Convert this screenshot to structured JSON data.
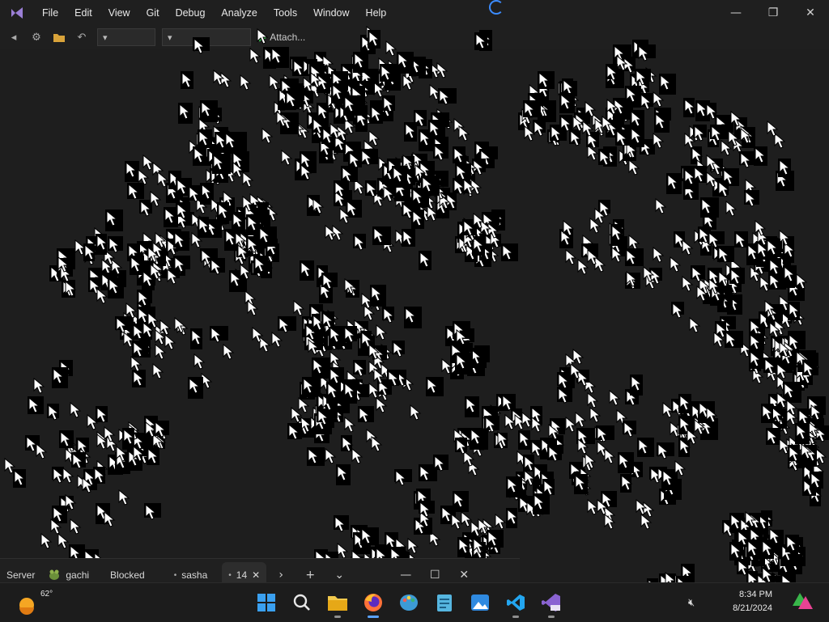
{
  "window": {
    "menu": [
      "File",
      "Edit",
      "View",
      "Git",
      "Debug",
      "Analyze",
      "Tools",
      "Window",
      "Help"
    ],
    "controls": {
      "minimize": "—",
      "restore": "❐",
      "close": "✕"
    }
  },
  "toolbar": {
    "run_label": "Attach..."
  },
  "terminal": {
    "tabs": [
      {
        "label": "Server",
        "icon": "terminal-icon"
      },
      {
        "label": "gachi",
        "icon": "frog-icon"
      },
      {
        "label": "Blocked",
        "icon": "terminal-icon"
      },
      {
        "label": "sasha",
        "icon": "dot-icon"
      },
      {
        "label": "14",
        "icon": "dot-icon",
        "active": true
      }
    ],
    "close_glyph": "✕",
    "scroll_glyph": "›",
    "new_tab_glyph": "+",
    "dropdown_glyph": "⌄",
    "minimize_glyph": "—",
    "maximize_glyph": "☐",
    "close_window_glyph": "✕"
  },
  "taskbar": {
    "weather": {
      "temp": "62°",
      "icon": "sunny-weather-icon"
    },
    "apps": [
      {
        "name": "start-icon",
        "running": false
      },
      {
        "name": "search-icon",
        "running": false
      },
      {
        "name": "file-explorer-icon",
        "running": true
      },
      {
        "name": "firefox-icon",
        "running": true,
        "active": true
      },
      {
        "name": "paint-icon",
        "running": false
      },
      {
        "name": "notepad-icon",
        "running": false
      },
      {
        "name": "photos-icon",
        "running": false
      },
      {
        "name": "vscode-icon",
        "running": true
      },
      {
        "name": "visual-studio-icon",
        "running": true
      }
    ],
    "clock": {
      "time": "8:34 PM",
      "date": "8/21/2024"
    },
    "tray": {
      "volume_icon": "speaker-muted-icon"
    }
  },
  "colors": {
    "background": "#1e1e1e",
    "artifact_black": "#000000",
    "artifact_white": "#ffffff",
    "accent_blue": "#3c8cff",
    "run_green": "#36b44a"
  }
}
